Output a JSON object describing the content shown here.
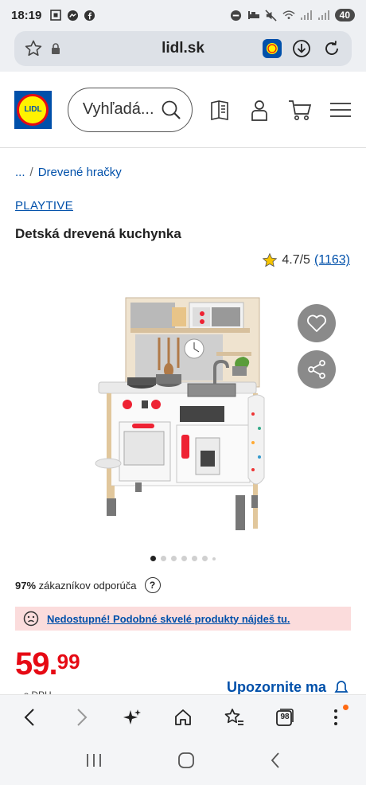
{
  "status": {
    "time": "18:19",
    "battery": "40"
  },
  "browser": {
    "url": "lidl.sk"
  },
  "header": {
    "logo_text": "LIDL",
    "search_placeholder": "Vyhľadá..."
  },
  "breadcrumb": {
    "ellipsis": "...",
    "separator": "/",
    "current": "Drevené hračky"
  },
  "product": {
    "brand": "PLAYTIVE",
    "title": "Detská drevená kuchynka",
    "rating": "4.7/5",
    "review_count": "(1163)",
    "image_dots": 7,
    "active_dot": 0
  },
  "recommend": {
    "percent": "97%",
    "text": "zákazníkov odporúča",
    "help": "?"
  },
  "alert": {
    "message": "Nedostupné! Podobné skvelé produkty nájdeš tu."
  },
  "price": {
    "integer": "59.",
    "decimal": "99",
    "vat_note": "s DPH"
  },
  "notify": {
    "label": "Upozornite ma"
  },
  "bottom_bar": {
    "tabs_count": "98"
  },
  "colors": {
    "lidl_blue": "#0050aa",
    "lidl_red": "#e60a14",
    "lidl_yellow": "#fff200",
    "alert_bg": "#fbdcdc"
  }
}
